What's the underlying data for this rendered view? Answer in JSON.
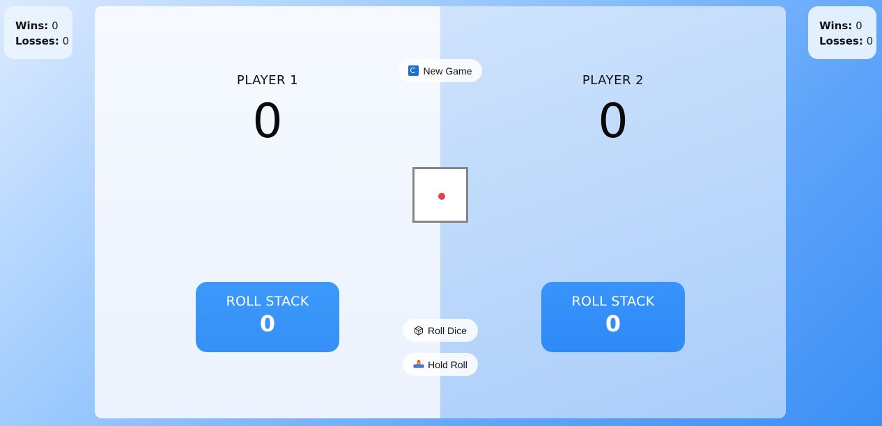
{
  "left_stats": {
    "wins_label": "Wins:",
    "wins": "0",
    "losses_label": "Losses:",
    "losses": "0"
  },
  "right_stats": {
    "wins_label": "Wins:",
    "wins": "0",
    "losses_label": "Losses:",
    "losses": "0"
  },
  "players": [
    {
      "name": "PLAYER 1",
      "score": "0",
      "stack_label": "ROLL STACK",
      "stack_value": "0"
    },
    {
      "name": "PLAYER 2",
      "score": "0",
      "stack_label": "ROLL STACK",
      "stack_value": "0"
    }
  ],
  "controls": {
    "new_game": "New Game",
    "roll_dice": "Roll Dice",
    "hold_roll": "Hold Roll"
  },
  "die": {
    "face": 1,
    "pip_color": "#e2434b"
  },
  "icons": {
    "new_game": "refresh-icon",
    "roll_dice": "dice-icon",
    "hold_roll": "hold-icon"
  }
}
